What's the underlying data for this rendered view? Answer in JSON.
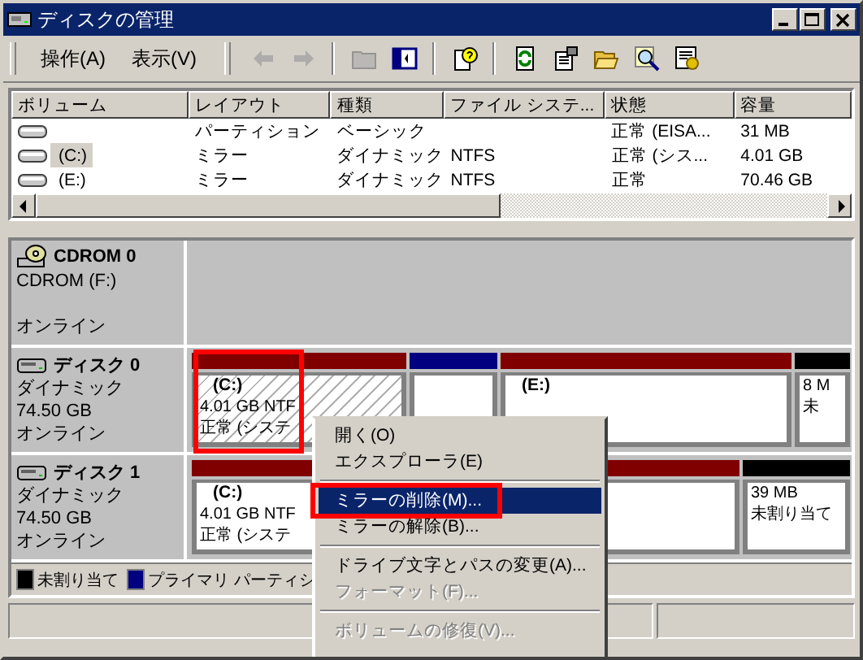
{
  "window": {
    "title": "ディスクの管理"
  },
  "menu": [
    {
      "label": "操作(A)"
    },
    {
      "label": "表示(V)"
    }
  ],
  "toolbar": [
    {
      "kind": "back",
      "disabled": true
    },
    {
      "kind": "forward",
      "disabled": true
    },
    {
      "kind": "folder",
      "disabled": true
    },
    {
      "kind": "panel",
      "disabled": false
    },
    {
      "kind": "help",
      "disabled": false
    },
    {
      "kind": "refresh",
      "disabled": false
    },
    {
      "kind": "properties",
      "disabled": false
    },
    {
      "kind": "open",
      "disabled": false
    },
    {
      "kind": "search",
      "disabled": false
    },
    {
      "kind": "settings",
      "disabled": false
    }
  ],
  "volumes": {
    "columns": [
      "ボリューム",
      "レイアウト",
      "種類",
      "ファイル システ...",
      "状態",
      "容量"
    ],
    "rows": [
      {
        "layout": "パーティション",
        "type": "ベーシック",
        "status": "正常 (EISA...",
        "capacity": "31 MB",
        "selected": false
      },
      {
        "volume": "(C:)",
        "layout": "ミラー",
        "type": "ダイナミック",
        "fs": "NTFS",
        "status": "正常 (シス...",
        "capacity": "4.01 GB",
        "selected": true
      },
      {
        "volume": "(E:)",
        "layout": "ミラー",
        "type": "ダイナミック",
        "fs": "NTFS",
        "status": "正常",
        "capacity": "70.46 GB",
        "selected": false
      }
    ]
  },
  "disks": [
    {
      "kind": "cdrom",
      "name": "CDROM 0",
      "type": "CDROM (F:)",
      "status": "オンライン"
    },
    {
      "kind": "disk",
      "name": "ディスク 0",
      "type": "ダイナミック",
      "size": "74.50 GB",
      "status": "オンライン",
      "partitions": [
        {
          "color": "#800000",
          "selected": true,
          "framed": true,
          "lines": [
            "(C:)",
            "4.01 GB NTF",
            "正常 (システ"
          ]
        },
        {
          "color": "#000080",
          "selected": false,
          "framed": false
        },
        {
          "color": "#800000",
          "selected": false,
          "framed": false,
          "lines": [
            "(E:)"
          ]
        },
        {
          "color": "#000000",
          "selected": false,
          "framed": false,
          "lines": [
            "8 M",
            "未"
          ]
        }
      ]
    },
    {
      "kind": "disk",
      "name": "ディスク 1",
      "type": "ダイナミック",
      "size": "74.50 GB",
      "status": "オンライン",
      "partitions": [
        {
          "color": "#800000",
          "selected": false,
          "framed": false,
          "lines": [
            "(C:)",
            "4.01 GB NTF",
            "正常 (システ"
          ]
        },
        {
          "color": "#000000",
          "selected": false,
          "framed": false,
          "lines": [
            "39 MB",
            "未割り当て"
          ]
        }
      ]
    }
  ],
  "legend": [
    {
      "color": "#000000",
      "label": "未割り当て"
    },
    {
      "color": "#000080",
      "label": "プライマリ パーティシ"
    }
  ],
  "context_menu": [
    {
      "kind": "item",
      "label": "開く(O)",
      "selected": false,
      "disabled": false,
      "framed": false
    },
    {
      "kind": "item",
      "label": "エクスプローラ(E)",
      "selected": false,
      "disabled": false,
      "framed": false
    },
    {
      "kind": "separator"
    },
    {
      "kind": "item",
      "label": "ミラーの削除(M)...",
      "selected": true,
      "disabled": false,
      "framed": true
    },
    {
      "kind": "item",
      "label": "ミラーの解除(B)...",
      "selected": false,
      "disabled": false,
      "framed": false
    },
    {
      "kind": "separator"
    },
    {
      "kind": "item",
      "label": "ドライブ文字とパスの変更(A)...",
      "selected": false,
      "disabled": false,
      "framed": false
    },
    {
      "kind": "item",
      "label": "フォーマット(F)...",
      "selected": false,
      "disabled": true,
      "framed": false
    },
    {
      "kind": "separator"
    },
    {
      "kind": "item",
      "label": "ボリュームの修復(V)...",
      "selected": false,
      "disabled": true,
      "framed": false
    }
  ]
}
